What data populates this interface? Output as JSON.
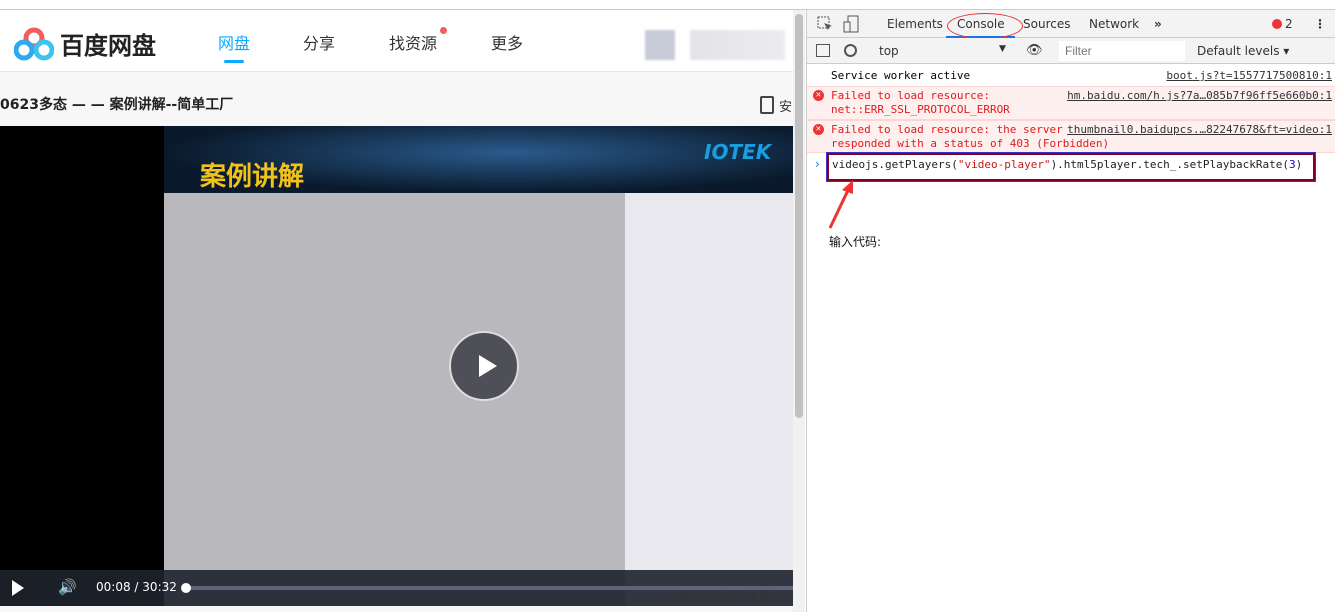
{
  "header": {
    "logo_text": "百度网盘",
    "nav": [
      {
        "label": "网盘",
        "active": true
      },
      {
        "label": "分享"
      },
      {
        "label": "找资源",
        "badge": true
      },
      {
        "label": "更多"
      }
    ]
  },
  "page": {
    "title": "0623多态 — — 案例讲解--简单工厂",
    "side_label": "安"
  },
  "video": {
    "slide_title": "案例讲解",
    "slide_logo": "IOTEK",
    "current_time": "00:08",
    "separator": "/",
    "duration": "30:32",
    "progress_fraction": 0.004,
    "company": "上海海同信息科技有限公司"
  },
  "devtools": {
    "tabs": [
      "Elements",
      "Console",
      "Sources",
      "Network"
    ],
    "active_tab": "Console",
    "more": "»",
    "error_count": "2",
    "context": "top",
    "filter_placeholder": "Filter",
    "levels": "Default levels ▾",
    "messages": [
      {
        "type": "info",
        "text": "Service worker active",
        "source": "boot.js?t=1557717500810:1"
      },
      {
        "type": "error",
        "text": "Failed to load resource:\nnet::ERR_SSL_PROTOCOL_ERROR",
        "source": "hm.baidu.com/h.js?7a…085b7f96ff5e660b0:1"
      },
      {
        "type": "error",
        "text": "Failed to load resource: the server\nresponded with a status of 403 (Forbidden)",
        "source": "thumbnail0.baidupcs.…82247678&ft=video:1"
      }
    ],
    "input": {
      "p1": "videojs.getPlayers(",
      "s": "\"video-player\"",
      "p2": ").html5player.tech_.setPlaybackRate(",
      "n": "3",
      "p3": ")"
    },
    "accent": "#1a73e8",
    "error_color": "#e01b1b"
  },
  "annotation": {
    "note": "输入代码:",
    "color": "#e33333"
  }
}
